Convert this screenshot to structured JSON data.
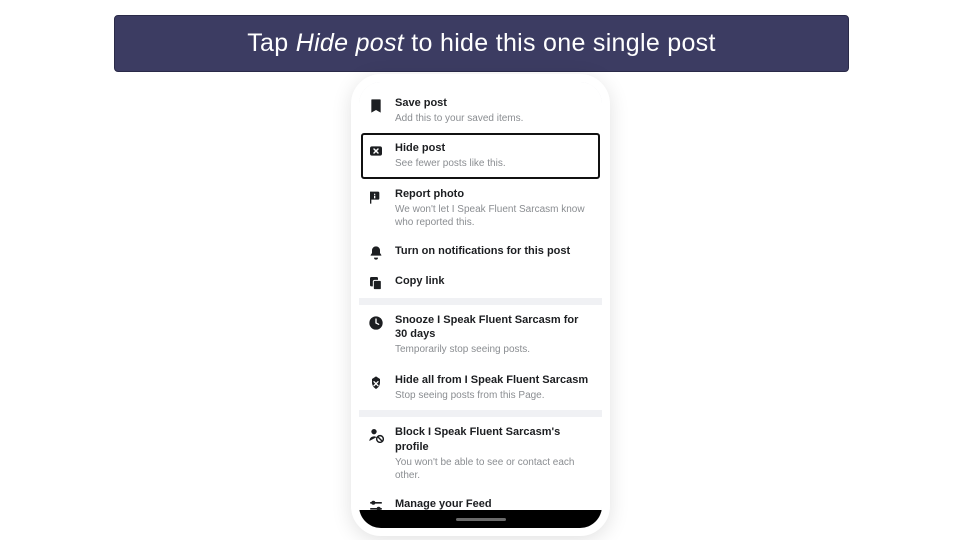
{
  "banner": {
    "prefix": "Tap ",
    "emphasis": "Hide post",
    "suffix": " to hide this one single post"
  },
  "menu": {
    "section1": [
      {
        "title": "Save post",
        "sub": "Add this to your saved items."
      },
      {
        "title": "Hide post",
        "sub": "See fewer posts like this."
      },
      {
        "title": "Report photo",
        "sub": "We won't let I Speak Fluent Sarcasm know who reported this."
      },
      {
        "title": "Turn on notifications for this post",
        "sub": ""
      },
      {
        "title": "Copy link",
        "sub": ""
      }
    ],
    "section2": [
      {
        "title": "Snooze I Speak Fluent Sarcasm for 30 days",
        "sub": "Temporarily stop seeing posts."
      },
      {
        "title": "Hide all from I Speak Fluent Sarcasm",
        "sub": "Stop seeing posts from this Page."
      }
    ],
    "section3": [
      {
        "title": "Block I Speak Fluent Sarcasm's profile",
        "sub": "You won't be able to see or contact each other."
      },
      {
        "title": "Manage your Feed",
        "sub": ""
      }
    ]
  }
}
